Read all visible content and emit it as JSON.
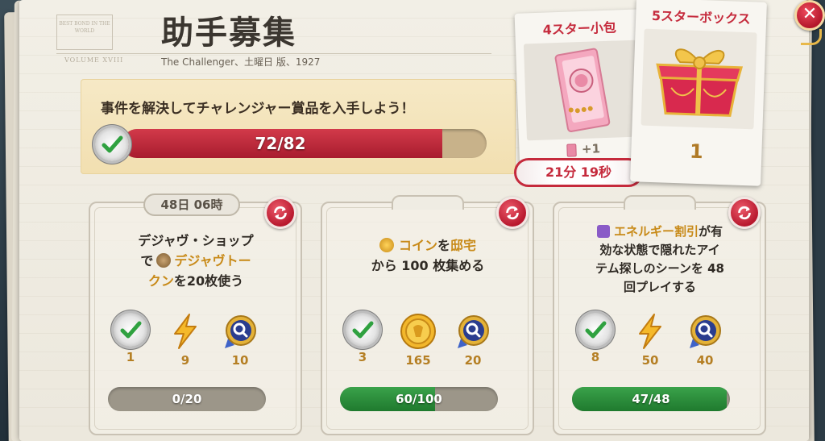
{
  "header": {
    "title": "助手募集",
    "subtitle": "The Challenger、土曜日 版、1927",
    "stamp_text": "BEST BOND IN THE WORLD",
    "volume_text": "VOLUME XVIII"
  },
  "banner": {
    "text": "事件を解決してチャレンジャー賞品を入手しよう！",
    "progress_text": "72/82",
    "progress_fraction": 0.878
  },
  "prizes": {
    "four_star": {
      "title": "4スター小包",
      "plus": "+1",
      "timer": "21分 19秒"
    },
    "five_star": {
      "title": "5スターボックス",
      "count": "1"
    }
  },
  "cards": [
    {
      "timer": "48日 06時",
      "desc_line1": "デジャヴ・ショップ",
      "desc_line2_a": "で",
      "desc_line2_b": "デジャヴトー",
      "desc_line3_a": "クン",
      "desc_line3_b": "を20枚使う",
      "rewards": [
        "1",
        "9",
        "10"
      ],
      "progress_text": "0/20",
      "progress_fraction": 0.0
    },
    {
      "desc_line1_a": "コイン",
      "desc_line1_b": "を",
      "desc_line1_c": "邸宅",
      "desc_line2": "から 100 枚集める",
      "rewards": [
        "3",
        "165",
        "20"
      ],
      "progress_text": "60/100",
      "progress_fraction": 0.6
    },
    {
      "desc_line1_a": "エネルギー割引",
      "desc_line1_b": "が有",
      "desc_line2": "効な状態で隠れたアイ",
      "desc_line3": "テム探しのシーンを 48",
      "desc_line4": "回プレイする",
      "rewards": [
        "8",
        "50",
        "40"
      ],
      "progress_text": "47/48",
      "progress_fraction": 0.979
    }
  ],
  "colors": {
    "accent_red": "#c52a3c",
    "gold": "#b57f24",
    "progress_green": "#2e8f3c"
  }
}
